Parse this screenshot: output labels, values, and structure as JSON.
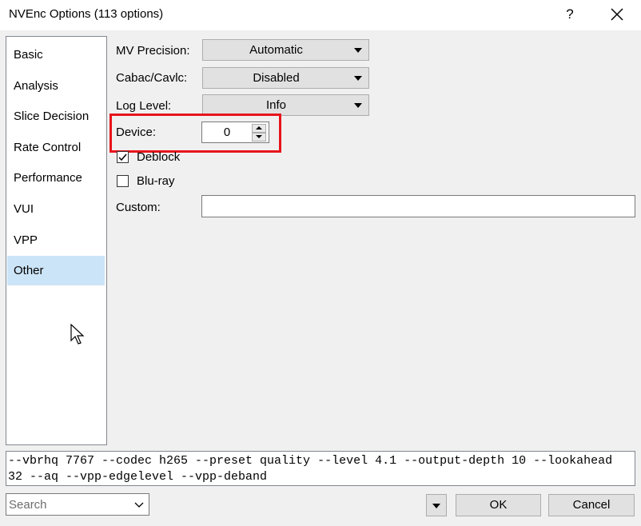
{
  "window": {
    "title": "NVEnc Options (113 options)",
    "help_label": "?"
  },
  "sidebar": {
    "items": [
      {
        "label": "Basic"
      },
      {
        "label": "Analysis"
      },
      {
        "label": "Slice Decision"
      },
      {
        "label": "Rate Control"
      },
      {
        "label": "Performance"
      },
      {
        "label": "VUI"
      },
      {
        "label": "VPP"
      },
      {
        "label": "Other",
        "selected": true
      }
    ]
  },
  "form": {
    "mv_precision": {
      "label": "MV Precision:",
      "value": "Automatic"
    },
    "cabac": {
      "label": "Cabac/Cavlc:",
      "value": "Disabled"
    },
    "log_level": {
      "label": "Log Level:",
      "value": "Info"
    },
    "device": {
      "label": "Device:",
      "value": "0"
    },
    "deblock": {
      "label": "Deblock",
      "checked": true
    },
    "bluray": {
      "label": "Blu-ray",
      "checked": false
    },
    "custom": {
      "label": "Custom:",
      "value": ""
    }
  },
  "command_line": {
    "line1": "--vbrhq 7767 --codec h265 --preset quality --level 4.1 --output-depth 10 --lookahead",
    "line2": "32 --aq --vpp-edgelevel --vpp-deband"
  },
  "footer": {
    "search_placeholder": "Search",
    "ok_label": "OK",
    "cancel_label": "Cancel"
  },
  "colors": {
    "highlight": "#e8141c",
    "selected_item": "#cce4f7"
  }
}
